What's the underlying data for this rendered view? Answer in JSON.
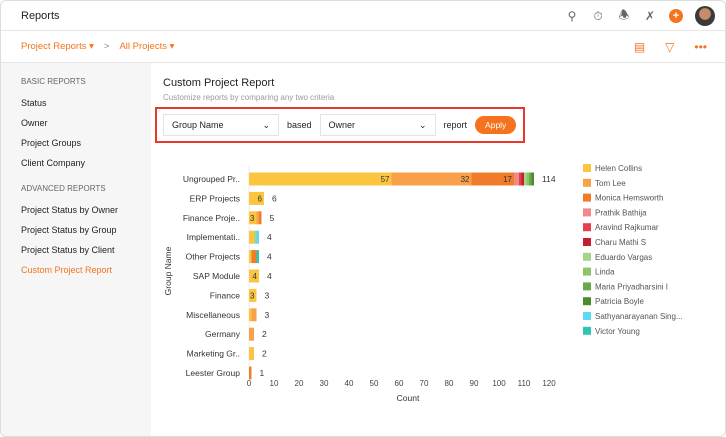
{
  "app": {
    "title": "Reports"
  },
  "topbar_icons": [
    "search-icon",
    "timer-icon",
    "bell-icon",
    "tools-icon",
    "plus-icon",
    "avatar"
  ],
  "breadcrumb": {
    "project_reports": "Project Reports ▾",
    "separator": ">",
    "all_projects": "All Projects ▾"
  },
  "subbar_icons": [
    "chart-icon",
    "filter-icon",
    "more-icon"
  ],
  "sidebar": {
    "basic_header": "BASIC REPORTS",
    "basic": [
      "Status",
      "Owner",
      "Project Groups",
      "Client Company"
    ],
    "advanced_header": "ADVANCED REPORTS",
    "advanced": [
      "Project Status by Owner",
      "Project Status by Group",
      "Project Status by Client",
      "Custom Project Report"
    ]
  },
  "main": {
    "title": "Custom Project Report",
    "subtitle": "Customize reports by comparing any two criteria",
    "criteria": {
      "first": "Group Name",
      "based": "based",
      "second": "Owner",
      "report": "report",
      "apply": "Apply"
    }
  },
  "chart_data": {
    "type": "bar",
    "orientation": "horizontal",
    "stacked": true,
    "xlabel": "Count",
    "ylabel": "Group Name",
    "xlim": [
      0,
      120
    ],
    "xticks": [
      0,
      10,
      20,
      30,
      40,
      50,
      60,
      70,
      80,
      90,
      100,
      110,
      120
    ],
    "legend_position": "right",
    "categories": [
      "Ungrouped Pr..",
      "ERP Projects",
      "Finance Proje..",
      "Implementati..",
      "Other Projects",
      "SAP Module",
      "Finance",
      "Miscellaneous",
      "Germany",
      "Marketing Gr..",
      "Leester Group"
    ],
    "totals": [
      114,
      6,
      5,
      4,
      4,
      4,
      3,
      3,
      2,
      2,
      1
    ],
    "series": [
      {
        "name": "Helen Collins",
        "color": "#fcc53f",
        "values": [
          57,
          6,
          3,
          2,
          1,
          4,
          3,
          1,
          0,
          2,
          0
        ]
      },
      {
        "name": "Tom Lee",
        "color": "#f9a14a",
        "values": [
          32,
          0,
          1,
          0,
          0,
          0,
          0,
          2,
          2,
          0,
          0
        ]
      },
      {
        "name": "Monica Hemsworth",
        "color": "#f07c2a",
        "values": [
          17,
          0,
          1,
          0,
          2,
          0,
          0,
          0,
          0,
          0,
          1
        ]
      },
      {
        "name": "Prathik Bathija",
        "color": "#f08a8a",
        "values": [
          2,
          0,
          0,
          0,
          0,
          0,
          0,
          0,
          0,
          0,
          0
        ]
      },
      {
        "name": "Aravind Rajkumar",
        "color": "#e5404f",
        "values": [
          1,
          0,
          0,
          0,
          0,
          0,
          0,
          0,
          0,
          0,
          0
        ]
      },
      {
        "name": "Charu Mathi S",
        "color": "#c41e32",
        "values": [
          1,
          0,
          0,
          0,
          0,
          0,
          0,
          0,
          0,
          0,
          0
        ]
      },
      {
        "name": "Eduardo Vargas",
        "color": "#a6d48a",
        "values": [
          1,
          0,
          0,
          1,
          0,
          0,
          0,
          0,
          0,
          0,
          0
        ]
      },
      {
        "name": "Linda",
        "color": "#8cc46a",
        "values": [
          1,
          0,
          0,
          0,
          0,
          0,
          0,
          0,
          0,
          0,
          0
        ]
      },
      {
        "name": "Maria Priyadharsini I",
        "color": "#6aa84f",
        "values": [
          1,
          0,
          0,
          0,
          0,
          0,
          0,
          0,
          0,
          0,
          0
        ]
      },
      {
        "name": "Patricia Boyle",
        "color": "#4f8a2e",
        "values": [
          1,
          0,
          0,
          0,
          0,
          0,
          0,
          0,
          0,
          0,
          0
        ]
      },
      {
        "name": "Sathyanarayanan Sing...",
        "color": "#5fd8f5",
        "values": [
          0,
          0,
          0,
          1,
          0,
          0,
          0,
          0,
          0,
          0,
          0
        ]
      },
      {
        "name": "Victor Young",
        "color": "#2ec4b6",
        "values": [
          0,
          0,
          0,
          0,
          1,
          0,
          0,
          0,
          0,
          0,
          0
        ]
      }
    ]
  }
}
